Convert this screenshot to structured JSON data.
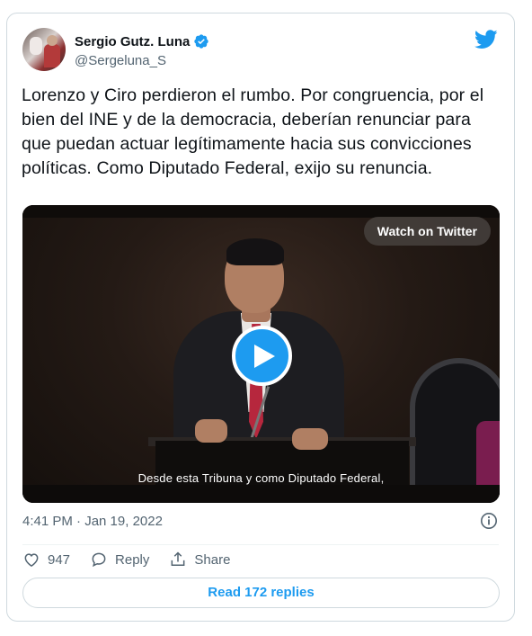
{
  "author": {
    "display_name": "Sergio Gutz. Luna",
    "handle": "@Sergeluna_S",
    "verified": true
  },
  "tweet": {
    "text": "Lorenzo y Ciro perdieron el rumbo. Por congruencia, por el bien del INE y de la democracia, deberían renunciar para que puedan actuar legítimamente hacia sus convicciones políticas. Como Diputado Federal, exijo su renuncia.",
    "timestamp": "4:41 PM · Jan 19, 2022"
  },
  "media": {
    "watch_label": "Watch on Twitter",
    "subtitle": "Desde esta Tribuna y como Diputado Federal,"
  },
  "actions": {
    "like_count": "947",
    "reply_label": "Reply",
    "share_label": "Share"
  },
  "footer": {
    "read_replies_label": "Read 172 replies"
  },
  "colors": {
    "accent": "#1d9bf0",
    "text": "#0f1419",
    "secondary": "#536471",
    "border": "#cfd9de"
  },
  "icons": [
    "verified-badge-icon",
    "twitter-bird-icon",
    "play-icon",
    "info-icon",
    "heart-icon",
    "reply-bubble-icon",
    "share-icon"
  ]
}
